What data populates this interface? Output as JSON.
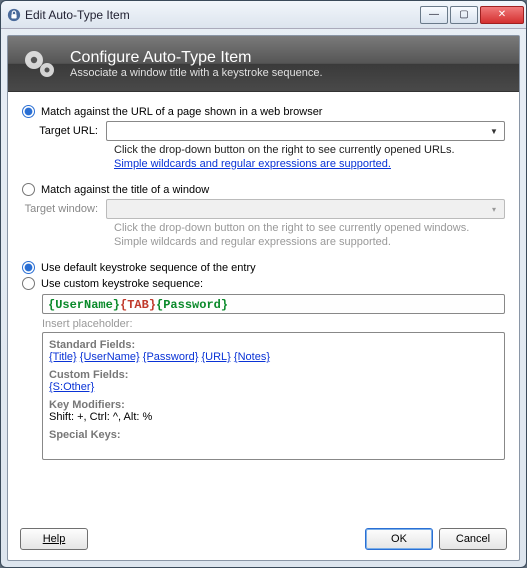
{
  "window": {
    "title": "Edit Auto-Type Item"
  },
  "banner": {
    "title": "Configure Auto-Type Item",
    "subtitle": "Associate a window title with a keystroke sequence."
  },
  "match": {
    "url_radio": "Match against the URL of a page shown in a web browser",
    "target_url_label": "Target URL:",
    "url_hint": "Click the drop-down button on the right to see currently opened URLs.",
    "url_link": "Simple wildcards and regular expressions are supported.",
    "title_radio": "Match against the title of a window",
    "target_window_label": "Target window:",
    "window_hint": "Click the drop-down button on the right to see currently opened windows.",
    "window_hint2": "Simple wildcards and regular expressions are supported."
  },
  "seq": {
    "default_radio": "Use default keystroke sequence of the entry",
    "custom_radio": "Use custom keystroke sequence:",
    "value_user": "{UserName}",
    "value_tab": "{TAB}",
    "value_pass": "{Password}",
    "insert_label": "Insert placeholder:"
  },
  "ph": {
    "std_head": "Standard Fields:",
    "std": {
      "title": "{Title}",
      "user": "{UserName}",
      "pass": "{Password}",
      "url": "{URL}",
      "notes": "{Notes}"
    },
    "cust_head": "Custom Fields:",
    "cust": "{S:Other}",
    "mod_head": "Key Modifiers:",
    "mod": "Shift: +, Ctrl: ^, Alt: %",
    "spec_head": "Special Keys:"
  },
  "footer": {
    "help": "Help",
    "ok": "OK",
    "cancel": "Cancel"
  }
}
